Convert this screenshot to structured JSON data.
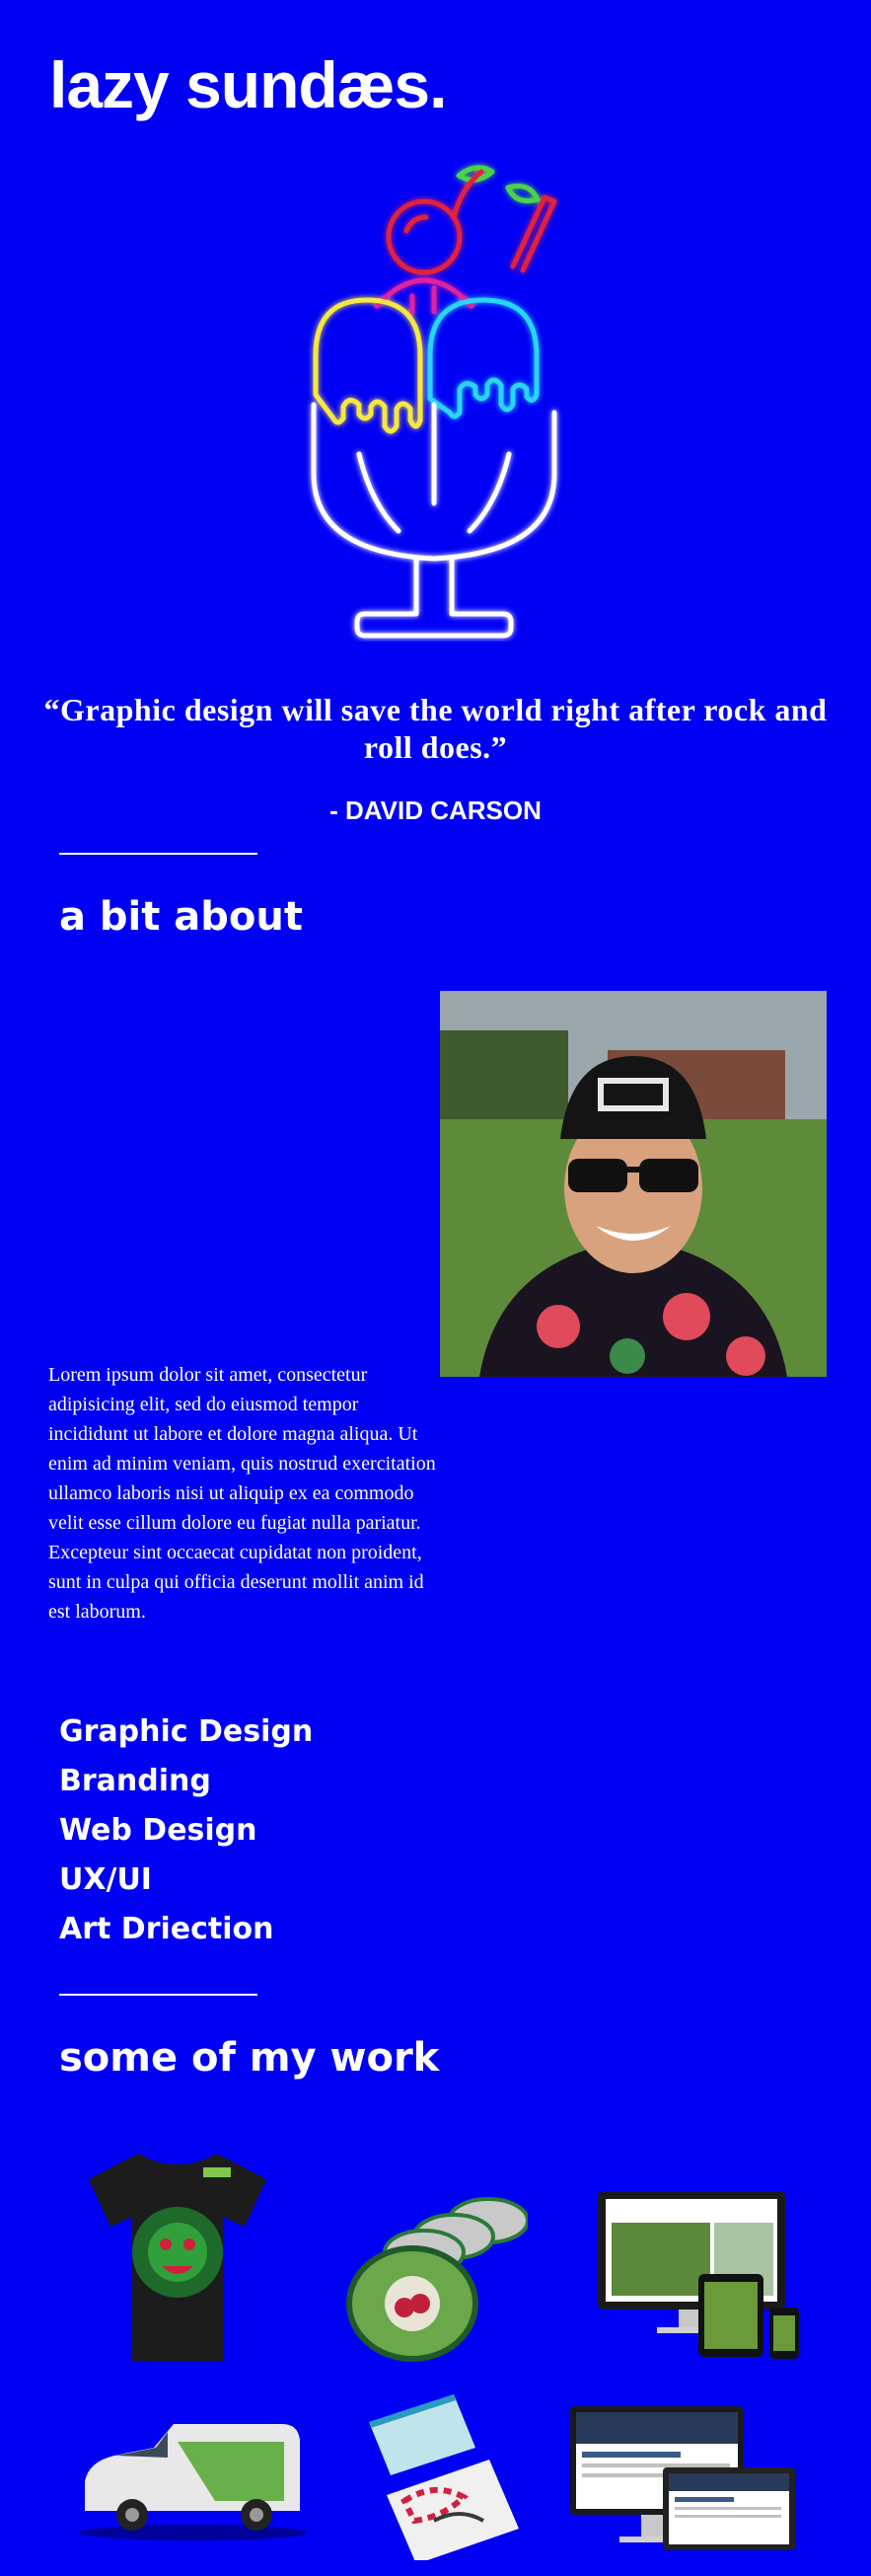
{
  "logo": {
    "text": "lazy sundæs."
  },
  "hero": {
    "image": "neon-ice-cream-sundae-illustration"
  },
  "quote": {
    "text": "“Graphic design will save the world right after rock and roll does.”",
    "author": "- DAVID CARSON"
  },
  "about": {
    "title": "a bit about",
    "photo": "portrait-photo",
    "bio": "Lorem ipsum dolor sit amet, consectetur adipisicing elit, sed do eiusmod tempor incididunt ut labore et dolore magna aliqua. Ut enim ad minim veniam, quis nostrud exercitation ullamco laboris nisi ut aliquip ex ea commodo velit esse cillum dolore eu fugiat nulla pariatur. Excepteur sint occaecat cupidatat non proident, sunt in culpa qui officia deserunt mollit anim id est laborum."
  },
  "skills": [
    "Graphic Design",
    "Branding",
    "Web Design",
    "UX/UI",
    "Art Driection"
  ],
  "work": {
    "title": "some of my work",
    "items": [
      "t-shirt-mockup",
      "coasters-mockup",
      "responsive-website-mockup",
      "van-wrap-mockup",
      "business-cards-mockup",
      "website-devices-mockup"
    ]
  },
  "colors": {
    "background": "#0000f5",
    "text": "#ffffff"
  }
}
